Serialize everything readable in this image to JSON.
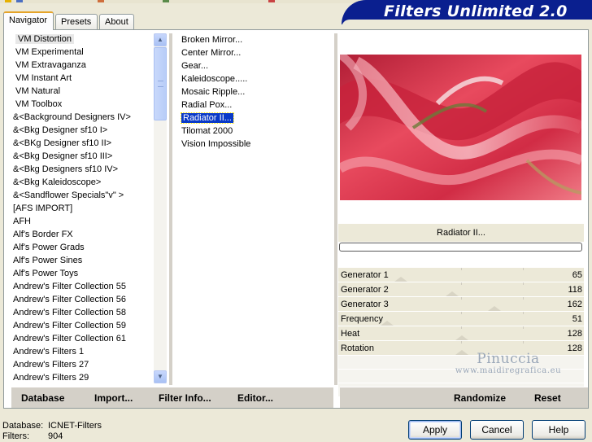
{
  "tabs": [
    "Navigator",
    "Presets",
    "About"
  ],
  "brand_title": "Filters Unlimited 2.0",
  "navigator_items": [
    "VM Distortion",
    "VM Experimental",
    "VM Extravaganza",
    "VM Instant Art",
    "VM Natural",
    "VM Toolbox",
    "&<Background Designers IV>",
    "&<Bkg Designer sf10 I>",
    "&<BKg Designer sf10 II>",
    "&<Bkg Designer sf10 III>",
    "&<Bkg Designers sf10 IV>",
    "&<Bkg Kaleidoscope>",
    "&<Sandflower Specials\"v\" >",
    "[AFS IMPORT]",
    "AFH",
    "Alf's Border FX",
    "Alf's Power Grads",
    "Alf's Power Sines",
    "Alf's Power Toys",
    "Andrew's Filter Collection 55",
    "Andrew's Filter Collection 56",
    "Andrew's Filter Collection 58",
    "Andrew's Filter Collection 59",
    "Andrew's Filter Collection 61",
    "Andrew's Filters 1",
    "Andrew's Filters 27",
    "Andrew's Filters 29"
  ],
  "filter_items": [
    "Broken Mirror...",
    "Center Mirror...",
    "Gear...",
    "Kaleidoscope.....",
    "Mosaic Ripple...",
    "Radial Pox...",
    "Radiator II...",
    "Tilomat 2000",
    "Vision Impossible"
  ],
  "selected_filter_name": "Radiator II...",
  "parameters": [
    {
      "name": "Generator 1",
      "value": "65"
    },
    {
      "name": "Generator 2",
      "value": "118"
    },
    {
      "name": "Generator 3",
      "value": "162"
    },
    {
      "name": "Frequency",
      "value": "51"
    },
    {
      "name": "Heat",
      "value": "128"
    },
    {
      "name": "Rotation",
      "value": "128"
    }
  ],
  "watermark": {
    "line1": "Pinuccia",
    "line2": "www.maidiregrafica.eu"
  },
  "bottom_left": {
    "database": "Database",
    "import": "Import...",
    "filter_info": "Filter Info...",
    "editor": "Editor..."
  },
  "bottom_right": {
    "randomize": "Randomize",
    "reset": "Reset"
  },
  "status": {
    "database_label": "Database:",
    "database_value": "ICNET-Filters",
    "filters_label": "Filters:",
    "filters_value": "904"
  },
  "dialog_buttons": {
    "apply": "Apply",
    "cancel": "Cancel",
    "help": "Help"
  },
  "scroll_arrows": {
    "up": "▲",
    "down": "▼"
  },
  "colors": {
    "brand": "#0a1f8f",
    "selection": "#0a3ac8",
    "accent_tab": "#e5a42a"
  }
}
